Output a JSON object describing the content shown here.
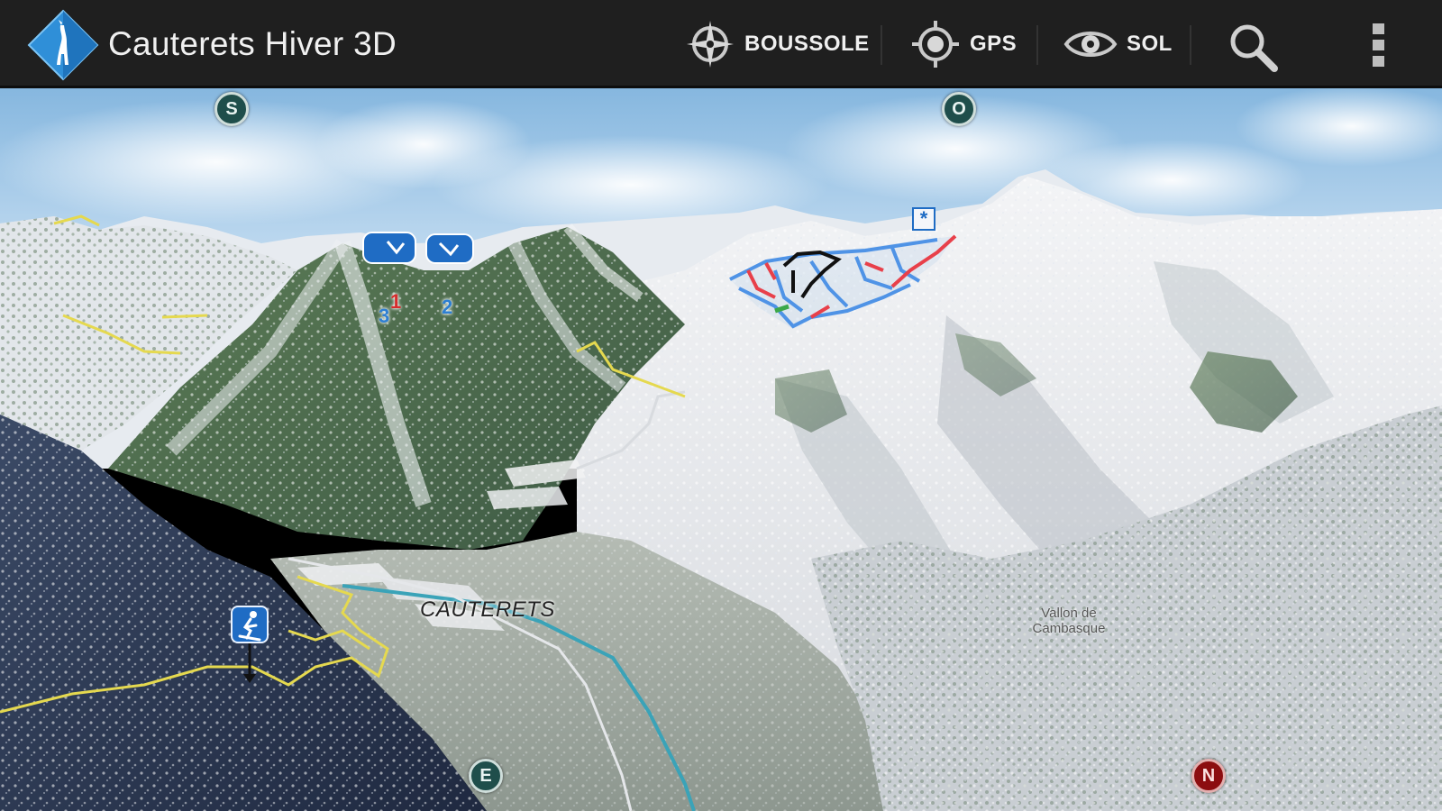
{
  "app": {
    "title": "Cauterets Hiver 3D"
  },
  "actions": {
    "compass_label": "BOUSSOLE",
    "gps_label": "GPS",
    "ground_label": "SOL"
  },
  "map": {
    "compass_markers": {
      "south": "S",
      "west": "O",
      "east": "E",
      "north": "N"
    },
    "labels": {
      "town": "CAUTERETS",
      "valley": "Vallon de Cambasque"
    },
    "poi_numbers": {
      "lift_1": "1",
      "lift_2": "2",
      "lift_3": "3"
    }
  },
  "colors": {
    "actionbar": "#1f1f1f",
    "accent_blue": "#1f6cc4",
    "piste_red": "#e8404a",
    "piste_blue": "#4f93e6",
    "piste_black": "#111111",
    "trail_yellow": "#e5d94f",
    "river": "#3aa3b8",
    "north_marker": "#8c0d10"
  },
  "icons": [
    "app-logo-icon",
    "compass-icon",
    "gps-icon",
    "eye-icon",
    "search-icon",
    "overflow-menu-icon",
    "skier-icon",
    "snowflake-icon"
  ]
}
